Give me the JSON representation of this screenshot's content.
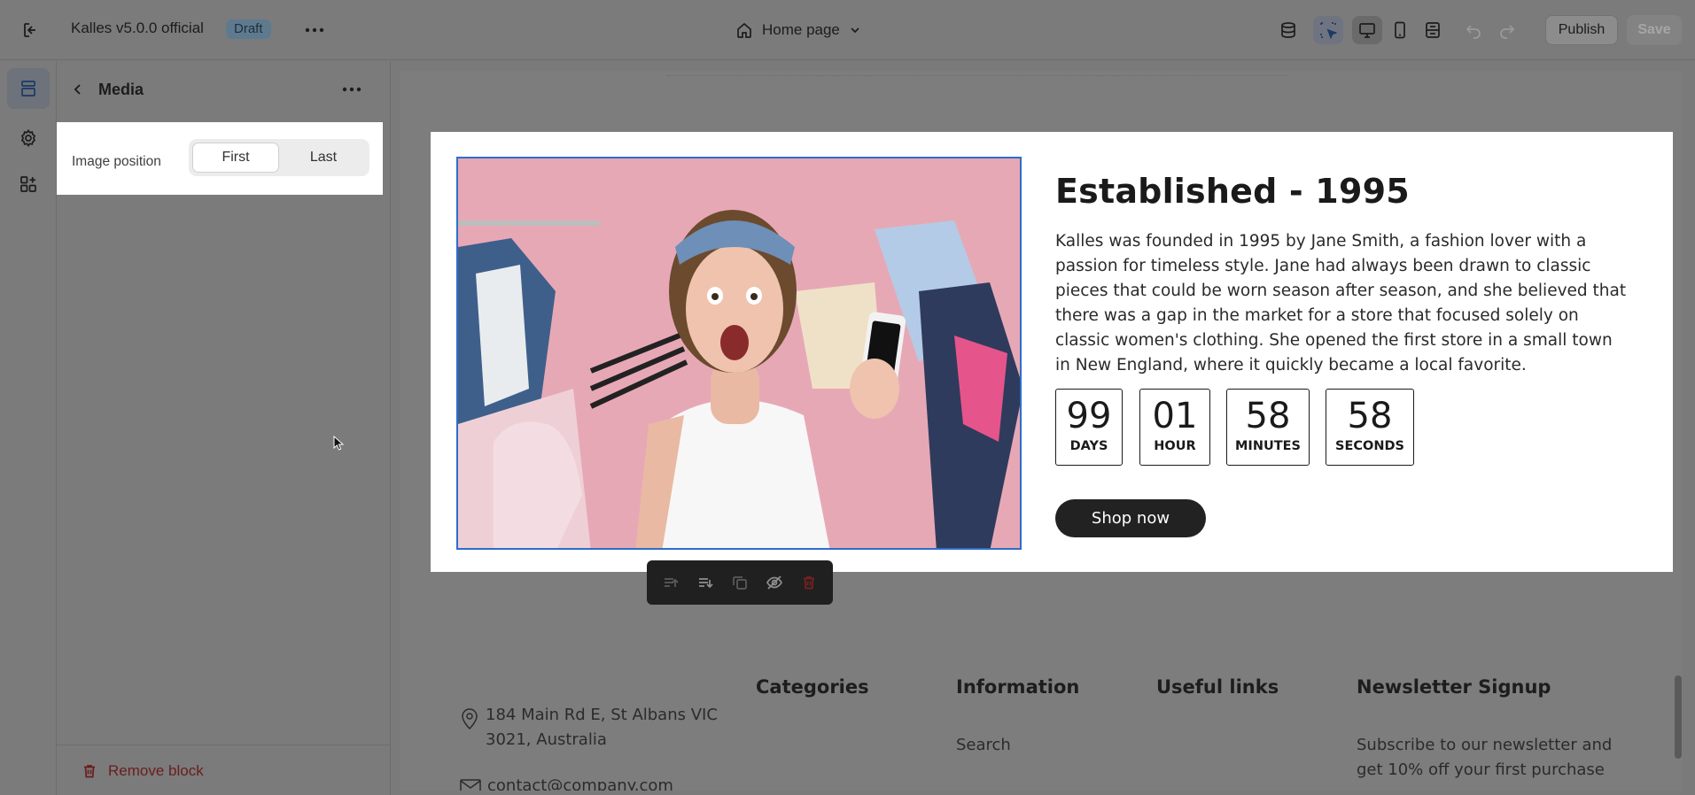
{
  "topbar": {
    "store_name": "Kalles v5.0.0 official",
    "status_badge": "Draft",
    "page_selector": "Home page",
    "publish_label": "Publish",
    "save_label": "Save"
  },
  "panel": {
    "title": "Media",
    "setting_label": "Image position",
    "options": [
      "First",
      "Last"
    ],
    "selected": "First",
    "remove_label": "Remove block"
  },
  "section": {
    "heading": "Established - 1995",
    "description": "Kalles was founded in 1995 by Jane Smith, a fashion lover with a passion for timeless style. Jane had always been drawn to classic pieces that could be worn season after season, and she believed that there was a gap in the market for a store that focused solely on classic women's clothing. She opened the first store in a small town in New England, where it quickly became a local favorite.",
    "countdown": [
      {
        "value": "99",
        "unit": "DAYS"
      },
      {
        "value": "01",
        "unit": "HOUR"
      },
      {
        "value": "58",
        "unit": "MINUTES"
      },
      {
        "value": "58",
        "unit": "SECONDS"
      }
    ],
    "button_label": "Shop now"
  },
  "footer": {
    "address_line1": "184 Main Rd E, St Albans VIC",
    "address_line2": "3021, Australia",
    "email": "contact@company.com",
    "col_categories": "Categories",
    "col_information": "Information",
    "col_useful_links": "Useful links",
    "col_newsletter": "Newsletter Signup",
    "info_link_search": "Search",
    "newsletter_text_line1": "Subscribe to our newsletter and",
    "newsletter_text_line2": "get 10% off your first purchase"
  },
  "colors": {
    "accent_selection": "#2c6ecb",
    "button_dark": "#222222",
    "danger": "#6a1d1d"
  },
  "icons": [
    "exit-icon",
    "more-icon",
    "home-icon",
    "chevron-down-icon",
    "database-icon",
    "select-icon",
    "desktop-icon",
    "mobile-icon",
    "fullwidth-icon",
    "undo-icon",
    "redo-icon",
    "sections-icon",
    "gear-icon",
    "apps-icon",
    "back-icon",
    "trash-icon",
    "location-icon",
    "mail-icon",
    "eye-off-icon",
    "duplicate-icon"
  ]
}
